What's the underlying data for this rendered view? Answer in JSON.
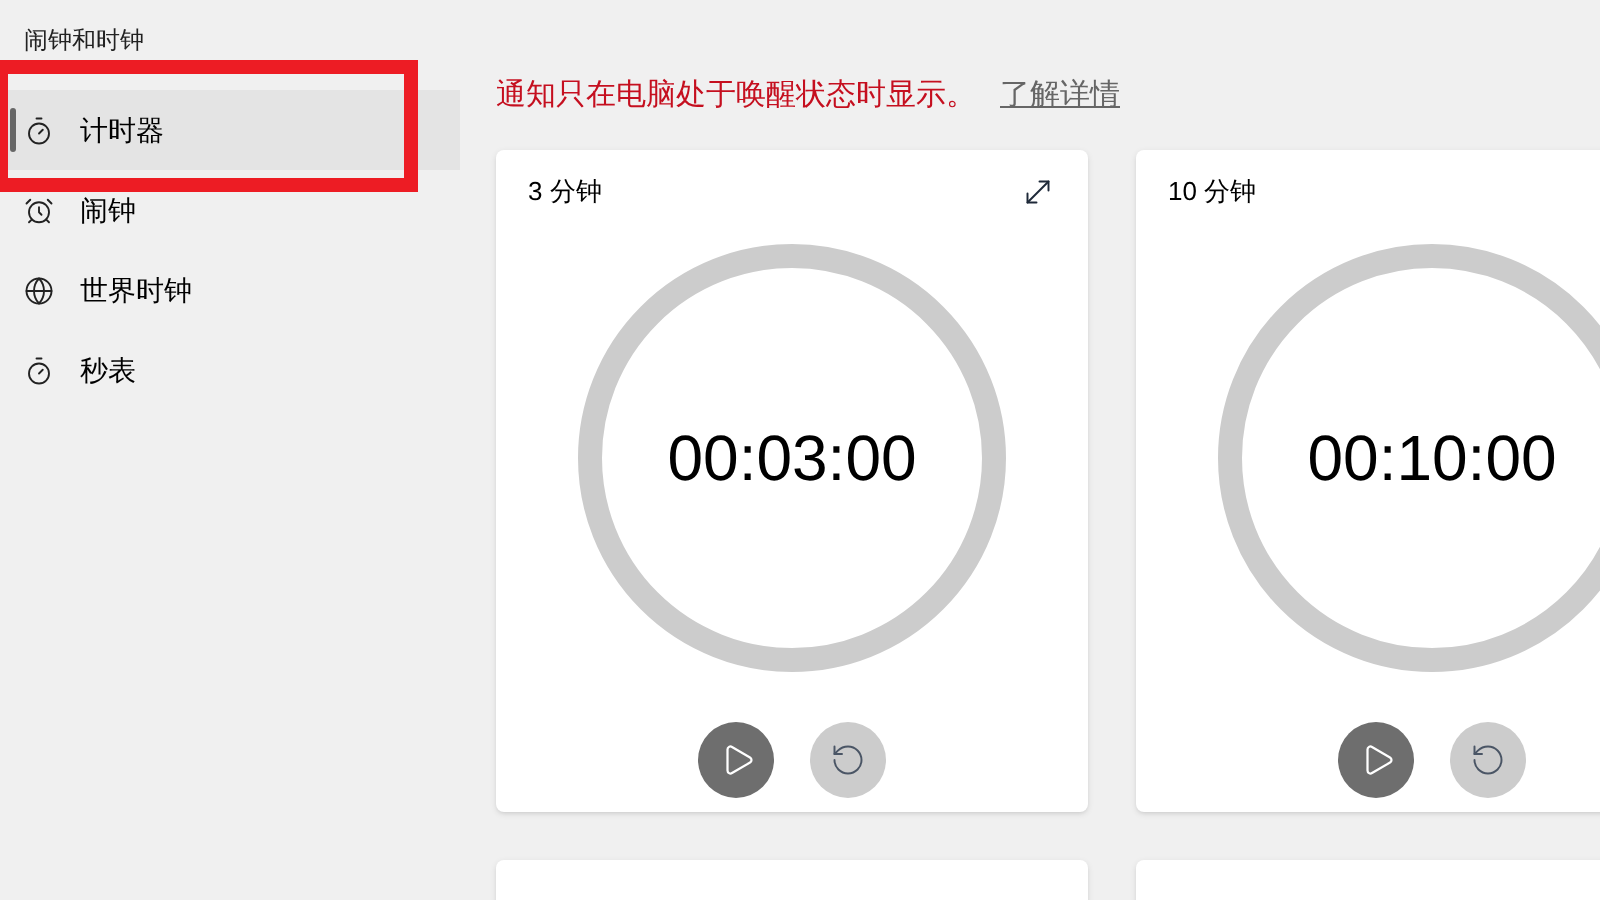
{
  "app_title": "闹钟和时钟",
  "nav": [
    {
      "label": "计时器",
      "selected": true
    },
    {
      "label": "闹钟",
      "selected": false
    },
    {
      "label": "世界时钟",
      "selected": false
    },
    {
      "label": "秒表",
      "selected": false
    }
  ],
  "notice": {
    "text": "通知只在电脑处于唤醒状态时显示。",
    "link": "了解详情"
  },
  "timers": [
    {
      "name": "3 分钟",
      "time": "00:03:00"
    },
    {
      "name": "10 分钟",
      "time": "00:10:00"
    }
  ]
}
